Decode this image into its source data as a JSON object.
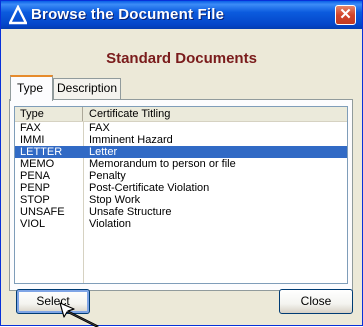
{
  "window": {
    "title": "Browse the Document File",
    "close_symbol": "✕"
  },
  "heading": "Standard Documents",
  "tabs": [
    {
      "label": "Type"
    },
    {
      "label": "Description"
    }
  ],
  "list": {
    "columns": [
      "Type",
      "Certificate Titling"
    ],
    "rows": [
      {
        "type": "FAX",
        "title": "FAX"
      },
      {
        "type": "IMMI",
        "title": "Imminent Hazard"
      },
      {
        "type": "LETTER",
        "title": "Letter"
      },
      {
        "type": "MEMO",
        "title": "Memorandum to person or file"
      },
      {
        "type": "PENA",
        "title": "Penalty"
      },
      {
        "type": "PENP",
        "title": "Post-Certificate Violation"
      },
      {
        "type": "STOP",
        "title": "Stop Work"
      },
      {
        "type": "UNSAFE",
        "title": "Unsafe Structure"
      },
      {
        "type": "VIOL",
        "title": "Violation"
      }
    ],
    "selected_row": "LETTER"
  },
  "buttons": {
    "select": "Select",
    "close": "Close"
  },
  "colors": {
    "titlebar": "#0b5bde",
    "heading": "#7a1c1c",
    "selection": "#316ac5",
    "close_button": "#d2442a"
  }
}
